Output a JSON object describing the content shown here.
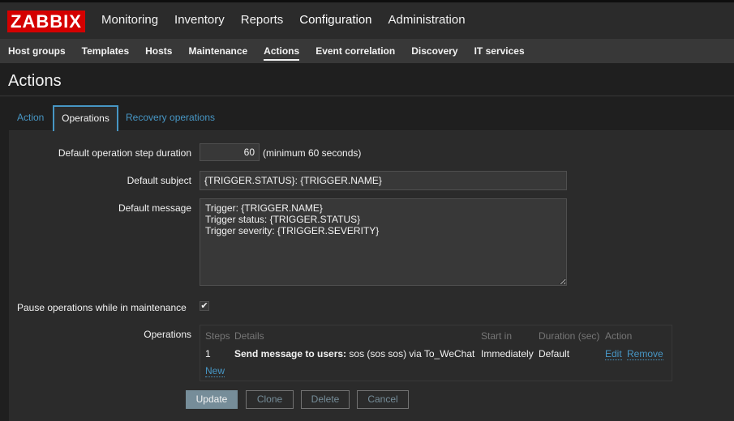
{
  "logo": "ZABBIX",
  "main_menu": [
    "Monitoring",
    "Inventory",
    "Reports",
    "Configuration",
    "Administration"
  ],
  "sub_menu": [
    "Host groups",
    "Templates",
    "Hosts",
    "Maintenance",
    "Actions",
    "Event correlation",
    "Discovery",
    "IT services"
  ],
  "page_title": "Actions",
  "tabs": [
    "Action",
    "Operations",
    "Recovery operations"
  ],
  "form": {
    "step_duration": {
      "label": "Default operation step duration",
      "value": "60",
      "hint": "(minimum 60 seconds)"
    },
    "subject": {
      "label": "Default subject",
      "value": "{TRIGGER.STATUS}: {TRIGGER.NAME}"
    },
    "message": {
      "label": "Default message",
      "value": "Trigger: {TRIGGER.NAME}\nTrigger status: {TRIGGER.STATUS}\nTrigger severity: {TRIGGER.SEVERITY}"
    },
    "pause": {
      "label": "Pause operations while in maintenance",
      "checked": true
    },
    "operations": {
      "label": "Operations",
      "headers": [
        "Steps",
        "Details",
        "Start in",
        "Duration (sec)",
        "Action"
      ],
      "rows": [
        {
          "steps": "1",
          "details_bold": "Send message to users:",
          "details_rest": " sos (sos sos) via To_WeChat",
          "start_in": "Immediately",
          "duration": "Default",
          "edit": "Edit",
          "remove": "Remove"
        }
      ],
      "new_link": "New"
    }
  },
  "buttons": {
    "update": "Update",
    "clone": "Clone",
    "delete": "Delete",
    "cancel": "Cancel"
  },
  "colors": {
    "brand": "#d40000",
    "link": "#4796c4",
    "primary_button": "#768d99"
  }
}
